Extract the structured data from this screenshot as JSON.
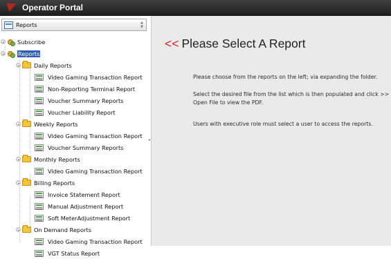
{
  "app": {
    "title": "Operator Portal"
  },
  "sidebar": {
    "header_label": "Reports",
    "tree": {
      "subscribe": "Subscribe",
      "reports": "Reports",
      "daily": {
        "label": "Daily Reports",
        "items": [
          "Video Gaming Transaction Report",
          "Non-Reporting Terminal Report",
          "Voucher Summary Reports",
          "Voucher Liability Report"
        ]
      },
      "weekly": {
        "label": "Weekly Reports",
        "items": [
          "Video Gaming Transaction Report",
          "Voucher Summary Reports"
        ]
      },
      "monthly": {
        "label": "Monthly Reports",
        "items": [
          "Video Gaming Transaction Report"
        ]
      },
      "billing": {
        "label": "Billing Reports",
        "items": [
          "Invoice Statement Report",
          "Manual Adjustment Report",
          "Soft MeterAdjustment Report"
        ]
      },
      "ondemand": {
        "label": "On Demand Reports",
        "items": [
          "Video Gaming Transaction Report",
          "VGT Status Report"
        ]
      }
    }
  },
  "main": {
    "heading_arrows": "<<",
    "heading_text": "Please Select A Report",
    "instruction_1": "Please choose from the reports on the left; via expanding the folder.",
    "instruction_2a": "Select the desired file from the list which is then populated and click >>",
    "instruction_2b": "Open File to view the PDF.",
    "instruction_3": "Users with executive role must select a user to access the reports."
  },
  "colors": {
    "titlebar": "#2b2b2b",
    "accent_red": "#cc1e1e",
    "selection": "#2f5fb3",
    "main_bg": "#eaeaea"
  }
}
